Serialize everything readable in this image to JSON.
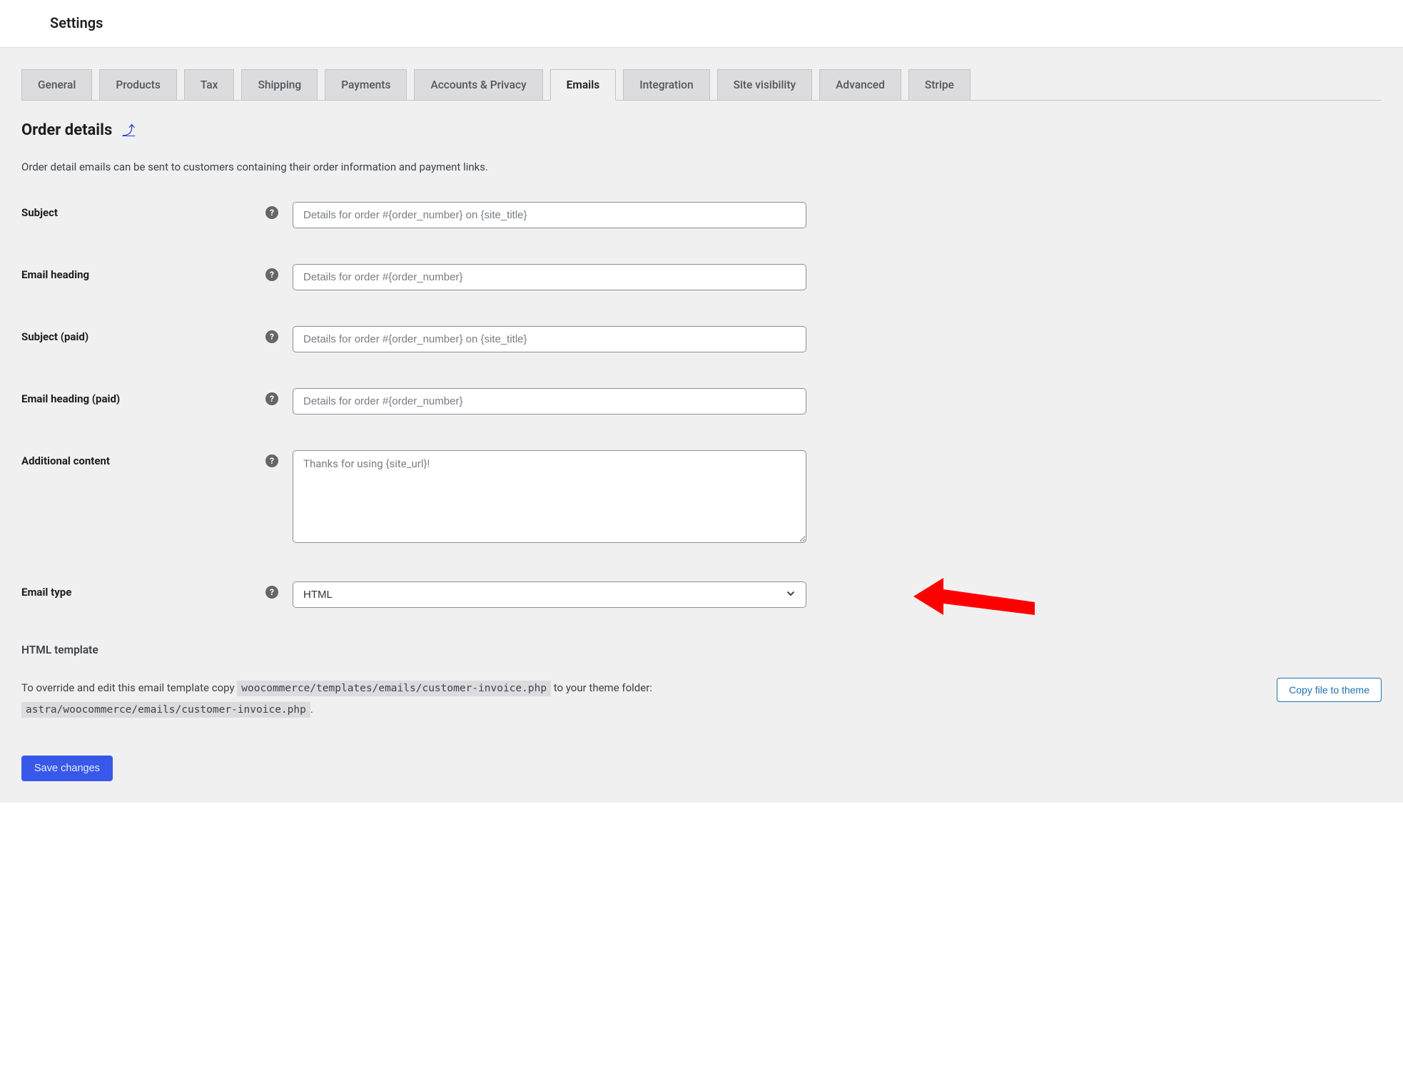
{
  "header": {
    "title": "Settings"
  },
  "tabs": [
    "General",
    "Products",
    "Tax",
    "Shipping",
    "Payments",
    "Accounts & Privacy",
    "Emails",
    "Integration",
    "Site visibility",
    "Advanced",
    "Stripe"
  ],
  "active_tab": "Emails",
  "section": {
    "title": "Order details",
    "back_glyph": "⤴",
    "description": "Order detail emails can be sent to customers containing their order information and payment links."
  },
  "fields": {
    "subject": {
      "label": "Subject",
      "placeholder": "Details for order #{order_number} on {site_title}",
      "value": ""
    },
    "email_heading": {
      "label": "Email heading",
      "placeholder": "Details for order #{order_number}",
      "value": ""
    },
    "subject_paid": {
      "label": "Subject (paid)",
      "placeholder": "Details for order #{order_number} on {site_title}",
      "value": ""
    },
    "email_heading_paid": {
      "label": "Email heading (paid)",
      "placeholder": "Details for order #{order_number}",
      "value": ""
    },
    "additional_content": {
      "label": "Additional content",
      "placeholder": "Thanks for using {site_url}!",
      "value": ""
    },
    "email_type": {
      "label": "Email type",
      "value": "HTML"
    }
  },
  "template": {
    "title": "HTML template",
    "text_pre": "To override and edit this email template copy ",
    "code1": "woocommerce/templates/emails/customer-invoice.php",
    "text_mid": " to your theme folder: ",
    "code2": "astra/woocommerce/emails/customer-invoice.php",
    "text_post": ".",
    "copy_button": "Copy file to theme"
  },
  "save_button": "Save changes",
  "help_glyph": "?"
}
